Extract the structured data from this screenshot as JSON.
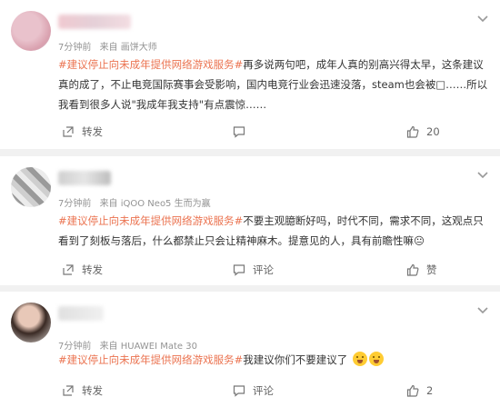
{
  "posts": [
    {
      "time": "7分钟前",
      "source": "来自 画饼大师",
      "hashtag": "#建议停止向未成年提供网络游戏服务#",
      "text": "再多说两句吧，成年人真的别高兴得太早，这条建议真的成了，不止电竞国际赛事会受影响，国内电竞行业会迅速没落，steam也会被□……所以我看到很多人说\"我成年我支持\"有点震惊……",
      "repost_label": "转发",
      "comment_label": "",
      "like_label": "20"
    },
    {
      "time": "7分钟前",
      "source": "来自 iQOO Neo5 生而为赢",
      "hashtag": "#建议停止向未成年提供网络游戏服务#",
      "text": "不要主观臆断好吗，时代不同，需求不同，这观点只看到了刻板与落后，什么都禁止只会让精神麻木。提意见的人，具有前瞻性嘛😐",
      "repost_label": "转发",
      "comment_label": "评论",
      "like_label": "赞"
    },
    {
      "time": "7分钟前",
      "source": "来自 HUAWEI Mate 30",
      "hashtag": "#建议停止向未成年提供网络游戏服务#",
      "text": "我建议你们不要建议了",
      "repost_label": "转发",
      "comment_label": "评论",
      "like_label": "2"
    }
  ],
  "icons": {
    "chevron": "chevron-down-icon",
    "repost": "repost-icon",
    "comment": "comment-icon",
    "like": "thumbs-up-icon",
    "emoji": "crying-face-emoji"
  },
  "colors": {
    "hashtag": "#eb7350",
    "meta": "#939393",
    "background": "#f1f1f1"
  }
}
